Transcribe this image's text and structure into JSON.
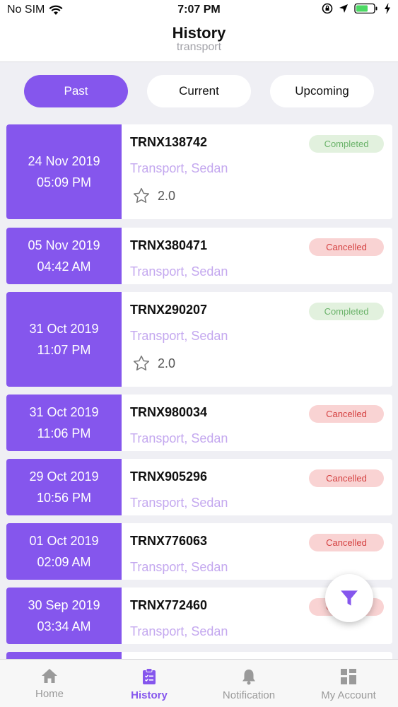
{
  "status_bar": {
    "carrier": "No SIM",
    "time": "7:07 PM"
  },
  "header": {
    "title": "History",
    "subtitle": "transport"
  },
  "segments": [
    {
      "label": "Past",
      "active": true
    },
    {
      "label": "Current",
      "active": false
    },
    {
      "label": "Upcoming",
      "active": false
    }
  ],
  "transactions": [
    {
      "date": "24 Nov 2019",
      "time": "05:09 PM",
      "id": "TRNX138742",
      "service": "Transport, Sedan",
      "status": "Completed",
      "rating": "2.0"
    },
    {
      "date": "05 Nov 2019",
      "time": "04:42 AM",
      "id": "TRNX380471",
      "service": "Transport, Sedan",
      "status": "Cancelled"
    },
    {
      "date": "31 Oct 2019",
      "time": "11:07 PM",
      "id": "TRNX290207",
      "service": "Transport, Sedan",
      "status": "Completed",
      "rating": "2.0"
    },
    {
      "date": "31 Oct 2019",
      "time": "11:06 PM",
      "id": "TRNX980034",
      "service": "Transport, Sedan",
      "status": "Cancelled"
    },
    {
      "date": "29 Oct 2019",
      "time": "10:56 PM",
      "id": "TRNX905296",
      "service": "Transport, Sedan",
      "status": "Cancelled"
    },
    {
      "date": "01 Oct 2019",
      "time": "02:09 AM",
      "id": "TRNX776063",
      "service": "Transport, Sedan",
      "status": "Cancelled"
    },
    {
      "date": "30 Sep 2019",
      "time": "03:34 AM",
      "id": "TRNX772460",
      "service": "Transport, Sedan",
      "status": "Cancelled"
    }
  ],
  "tabs": [
    {
      "label": "Home",
      "icon": "home-icon",
      "active": false
    },
    {
      "label": "History",
      "icon": "clipboard-icon",
      "active": true
    },
    {
      "label": "Notification",
      "icon": "bell-icon",
      "active": false
    },
    {
      "label": "My Account",
      "icon": "grid-icon",
      "active": false
    }
  ],
  "colors": {
    "accent": "#8556ed",
    "completed_bg": "#e2f1de",
    "completed_text": "#6bb36a",
    "cancelled_bg": "#f9d3d3",
    "cancelled_text": "#d43f3f"
  }
}
